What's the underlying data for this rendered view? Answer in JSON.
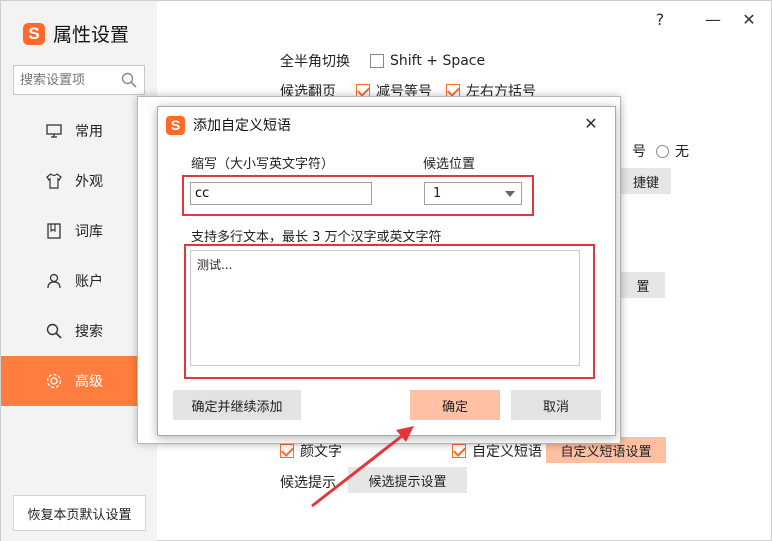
{
  "app": {
    "title": "属性设置",
    "logo_letter": "S"
  },
  "window_controls": {
    "help": "?",
    "minimize": "—",
    "close": "✕"
  },
  "search": {
    "placeholder": "搜索设置项"
  },
  "sidebar": {
    "items": [
      {
        "label": "常用",
        "icon": "monitor-icon"
      },
      {
        "label": "外观",
        "icon": "shirt-icon"
      },
      {
        "label": "词库",
        "icon": "book-icon"
      },
      {
        "label": "账户",
        "icon": "user-icon"
      },
      {
        "label": "搜索",
        "icon": "search-icon"
      },
      {
        "label": "高级",
        "icon": "gear-icon",
        "active": true
      }
    ],
    "restore_label": "恢复本页默认设置"
  },
  "background": {
    "fullhalf_label": "全半角切换",
    "fullhalf_option": "Shift + Space",
    "page_label": "候选翻页",
    "page_opt1": "减号等号",
    "page_opt2": "左右方括号",
    "partial_right_1": "号",
    "radio_none": "无",
    "partial_btn_1": "捷键",
    "partial_btn_2": "置",
    "yanwenzi": "颜文字",
    "custom_phrase": "自定义短语",
    "custom_phrase_btn": "自定义短语设置",
    "hint_label": "候选提示",
    "hint_btn": "候选提示设置"
  },
  "dialog": {
    "title": "添加自定义短语",
    "close": "✕",
    "abbr_label": "缩写（大小写英文字符）",
    "abbr_value": "cc",
    "position_label": "候选位置",
    "position_value": "1",
    "text_label": "支持多行文本，最长 3 万个汉字或英文字符",
    "text_value": "测试...",
    "btn_continue": "确定并继续添加",
    "btn_ok": "确定",
    "btn_cancel": "取消"
  },
  "colors": {
    "accent": "#ff7e3f",
    "highlight": "#e0383a",
    "primary_btn": "#ffc0a3"
  }
}
